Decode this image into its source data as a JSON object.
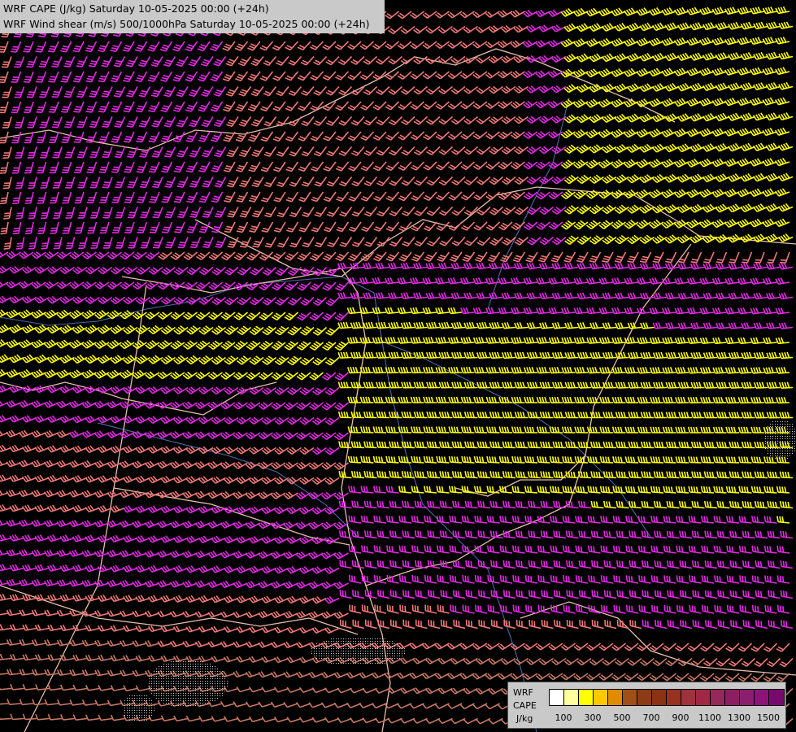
{
  "titles": {
    "line1": "WRF CAPE (J/kg) Saturday 10-05-2025 00:00 (+24h)",
    "line2": "WRF Wind shear (m/s) 500/1000hPa Saturday 10-05-2025 00:00 (+24h)"
  },
  "legend": {
    "label_top": "WRF",
    "label_mid": "CAPE",
    "label_unit": "J/kg",
    "colors": [
      "#ffffff",
      "#ffffa0",
      "#ffff00",
      "#ffc800",
      "#e08c00",
      "#a05014",
      "#8c3c14",
      "#8c3214",
      "#96321e",
      "#a0323c",
      "#a02846",
      "#96285a",
      "#8c1e64",
      "#8c1e6e",
      "#8c1478",
      "#780a6e"
    ],
    "ticks": [
      "100",
      "300",
      "500",
      "700",
      "900",
      "1100",
      "1300",
      "1500"
    ]
  },
  "barb_colors": {
    "weak": "#c87864",
    "moderate": "#f07878",
    "strong": "#e628e6",
    "very_strong": "#ffff00",
    "border": "#e6beaa",
    "river": "#4a6aaa"
  }
}
